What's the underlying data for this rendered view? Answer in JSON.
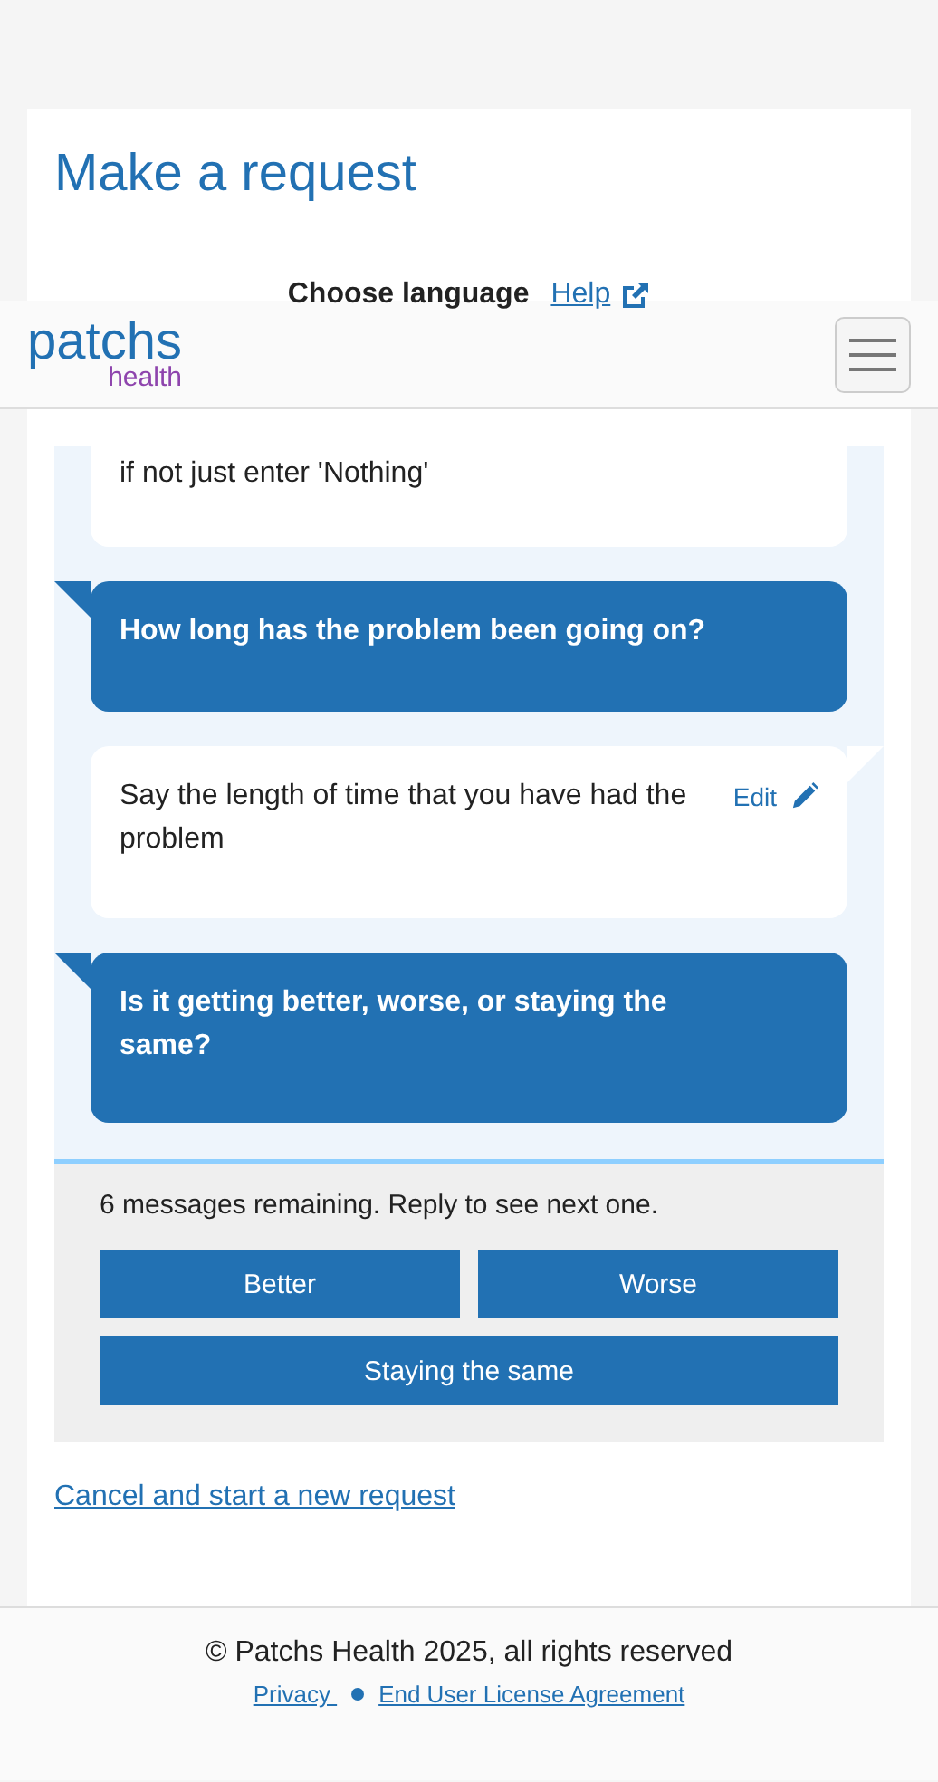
{
  "page": {
    "title": "Make a request",
    "language_label": "Choose language",
    "help_link": "Help"
  },
  "header": {
    "logo_main": "patchs",
    "logo_sub": "health"
  },
  "messages": [
    {
      "kind": "answer",
      "text": "if not just enter 'Nothing'"
    },
    {
      "kind": "question",
      "text": "How long has the problem been going on?"
    },
    {
      "kind": "answer",
      "text": "Say the length of time that you have had the problem",
      "edit": "Edit"
    },
    {
      "kind": "question",
      "text": "Is it getting better, worse, or staying the same?"
    }
  ],
  "reply": {
    "remaining": "6 messages remaining. Reply to see next one.",
    "options": [
      {
        "label": "Better"
      },
      {
        "label": "Worse"
      },
      {
        "label": "Staying the same"
      }
    ]
  },
  "cancel_link": "Cancel and start a new request",
  "footer": {
    "copyright": "© Patchs Health 2025, all rights reserved",
    "links": [
      "Privacy ",
      "End User License Agreement"
    ]
  }
}
